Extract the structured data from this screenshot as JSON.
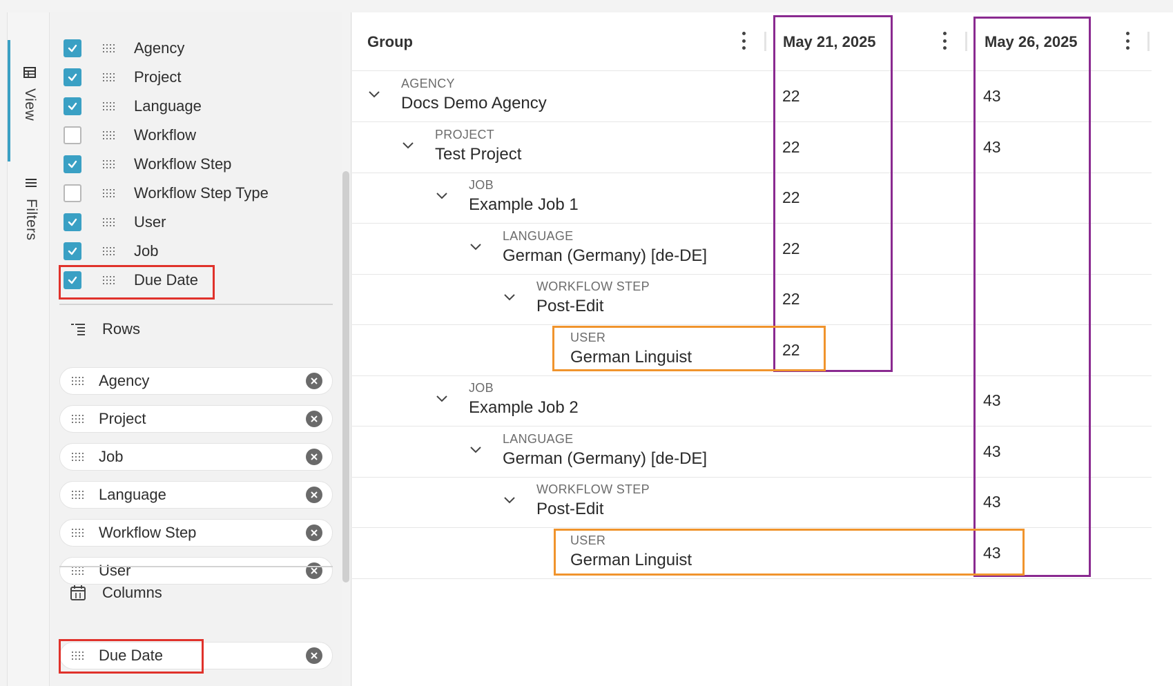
{
  "rail": {
    "tabs": [
      {
        "label": "View",
        "icon": "table-icon",
        "active": true
      },
      {
        "label": "Filters",
        "icon": "filter-lines-icon",
        "active": false
      }
    ]
  },
  "fields": [
    {
      "label": "Agency",
      "checked": true
    },
    {
      "label": "Project",
      "checked": true
    },
    {
      "label": "Language",
      "checked": true
    },
    {
      "label": "Workflow",
      "checked": false
    },
    {
      "label": "Workflow Step",
      "checked": true
    },
    {
      "label": "Workflow Step Type",
      "checked": false
    },
    {
      "label": "User",
      "checked": true
    },
    {
      "label": "Job",
      "checked": true
    },
    {
      "label": "Due Date",
      "checked": true
    }
  ],
  "rows_section": {
    "title": "Rows",
    "chips": [
      "Agency",
      "Project",
      "Job",
      "Language",
      "Workflow Step",
      "User"
    ]
  },
  "columns_section": {
    "title": "Columns",
    "chips": [
      "Due Date"
    ]
  },
  "table": {
    "headers": [
      "Group",
      "May 21, 2025",
      "May 26, 2025"
    ],
    "rows": [
      {
        "type": "AGENCY",
        "name": "Docs Demo Agency",
        "col1": "22",
        "col2": "43",
        "expandable": true
      },
      {
        "type": "PROJECT",
        "name": "Test Project",
        "col1": "22",
        "col2": "43",
        "expandable": true
      },
      {
        "type": "JOB",
        "name": "Example Job 1",
        "col1": "22",
        "col2": "",
        "expandable": true
      },
      {
        "type": "LANGUAGE",
        "name": "German (Germany) [de-DE]",
        "col1": "22",
        "col2": "",
        "expandable": true
      },
      {
        "type": "WORKFLOW STEP",
        "name": "Post-Edit",
        "col1": "22",
        "col2": "",
        "expandable": true
      },
      {
        "type": "USER",
        "name": "German Linguist",
        "col1": "22",
        "col2": "",
        "expandable": false
      },
      {
        "type": "JOB",
        "name": "Example Job 2",
        "col1": "",
        "col2": "43",
        "expandable": true
      },
      {
        "type": "LANGUAGE",
        "name": "German (Germany) [de-DE]",
        "col1": "",
        "col2": "43",
        "expandable": true
      },
      {
        "type": "WORKFLOW STEP",
        "name": "Post-Edit",
        "col1": "",
        "col2": "43",
        "expandable": true
      },
      {
        "type": "USER",
        "name": "German Linguist",
        "col1": "",
        "col2": "43",
        "expandable": false
      }
    ]
  },
  "colors": {
    "accent": "#3aa0c4",
    "highlight_red": "#e0322b",
    "highlight_purple": "#8a2a90",
    "highlight_orange": "#f0942d"
  }
}
